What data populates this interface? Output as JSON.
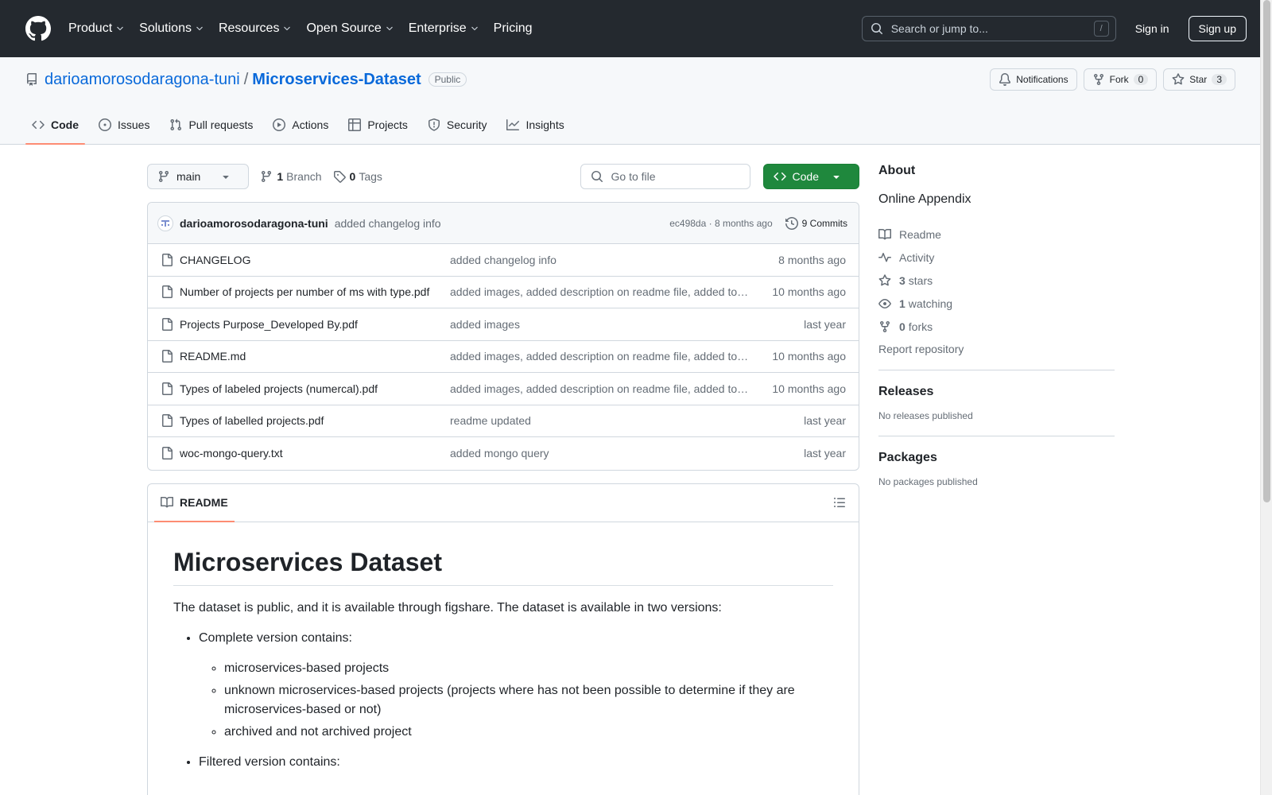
{
  "header": {
    "nav": [
      "Product",
      "Solutions",
      "Resources",
      "Open Source",
      "Enterprise",
      "Pricing"
    ],
    "search_placeholder": "Search or jump to...",
    "search_shortcut": "/",
    "sign_in": "Sign in",
    "sign_up": "Sign up"
  },
  "repo": {
    "owner": "darioamorosodaragona-tuni",
    "separator": "/",
    "name": "Microservices-Dataset",
    "visibility": "Public",
    "notifications_label": "Notifications",
    "fork_label": "Fork",
    "fork_count": "0",
    "star_label": "Star",
    "star_count": "3",
    "tabs": [
      "Code",
      "Issues",
      "Pull requests",
      "Actions",
      "Projects",
      "Security",
      "Insights"
    ]
  },
  "toolbar": {
    "branch": "main",
    "branch_count": "1",
    "branch_label": "Branch",
    "tag_count": "0",
    "tag_label": "Tags",
    "goto_placeholder": "Go to file",
    "code_label": "Code"
  },
  "commit": {
    "author": "darioamorosodaragona-tuni",
    "message": "added changelog info",
    "hash_time": "ec498da · 8 months ago",
    "commits_label": "9 Commits"
  },
  "files": [
    {
      "name": "CHANGELOG",
      "message": "added changelog info",
      "time": "8 months ago"
    },
    {
      "name": "Number of projects per number of ms with type.pdf",
      "message": "added images, added description on readme file, added todo list",
      "time": "10 months ago"
    },
    {
      "name": "Projects Purpose_Developed By.pdf",
      "message": "added images",
      "time": "last year"
    },
    {
      "name": "README.md",
      "message": "added images, added description on readme file, added todo list",
      "time": "10 months ago"
    },
    {
      "name": "Types of labeled projects (numercal).pdf",
      "message": "added images, added description on readme file, added todo list",
      "time": "10 months ago"
    },
    {
      "name": "Types of labelled projects.pdf",
      "message": "readme updated",
      "time": "last year"
    },
    {
      "name": "woc-mongo-query.txt",
      "message": "added mongo query",
      "time": "last year"
    }
  ],
  "readme": {
    "tab_label": "README",
    "title": "Microservices Dataset",
    "intro": "The dataset is public, and it is available through figshare. The dataset is available in two versions:",
    "complete_label": "Complete version contains:",
    "complete_items": [
      "microservices-based projects",
      "unknown microservices-based projects (projects where has not been possible to determine if they are microservices-based or not)",
      "archived and not archived project"
    ],
    "filtered_label": "Filtered version contains:"
  },
  "about": {
    "heading": "About",
    "description": "Online Appendix",
    "readme": "Readme",
    "activity": "Activity",
    "stars_count": "3",
    "stars_label": "stars",
    "watching_count": "1",
    "watching_label": "watching",
    "forks_count": "0",
    "forks_label": "forks",
    "report": "Report repository",
    "releases_heading": "Releases",
    "releases_text": "No releases published",
    "packages_heading": "Packages",
    "packages_text": "No packages published"
  },
  "colors": {
    "header_bg": "#24292f",
    "link": "#0969da",
    "primary_button": "#1f883d",
    "tab_underline": "#fd8c73"
  }
}
